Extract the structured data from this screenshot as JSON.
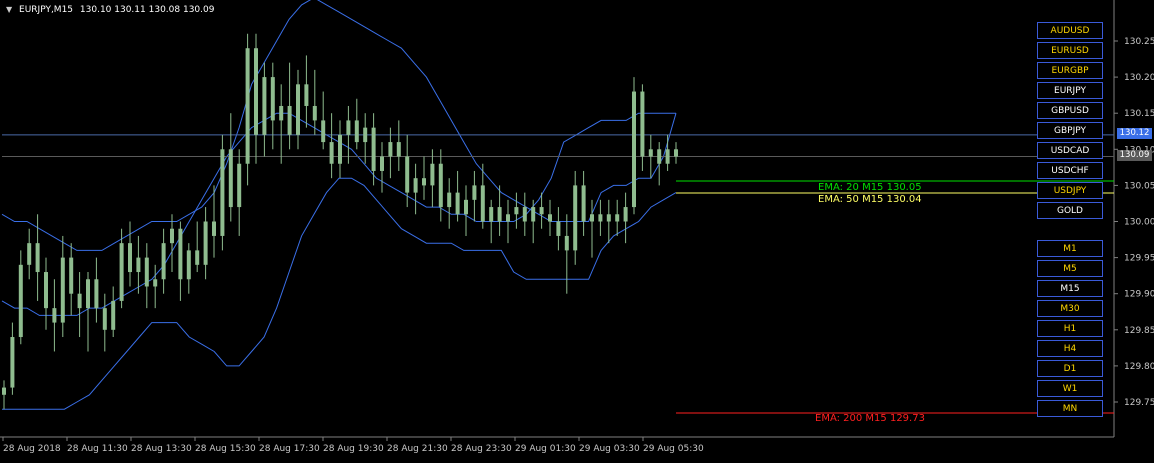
{
  "header": {
    "symbol": "EURJPY,M15",
    "ohlc": "130.10 130.11 130.08 130.09"
  },
  "colors": {
    "background": "#000000",
    "candle": "#8fbc8f",
    "bands": "#3a6fe8",
    "grid_line": "#4a6aa8",
    "ema20": "#00e000",
    "ema50": "#ffff66",
    "ema200": "#ff2020",
    "button_border": "#3a5ad8",
    "button_text_active": "#ffd700"
  },
  "price_axis": {
    "ticks": [
      "130.25",
      "130.20",
      "130.15",
      "130.10",
      "130.05",
      "130.00",
      "129.95",
      "129.90",
      "129.85",
      "129.80",
      "129.75"
    ],
    "current_tag": "130.09",
    "line_tag": "130.12",
    "tick_values": [
      130.25,
      130.2,
      130.15,
      130.1,
      130.05,
      130.0,
      129.95,
      129.9,
      129.85,
      129.8,
      129.75
    ]
  },
  "time_axis": {
    "ticks": [
      "28 Aug 2018",
      "28 Aug 11:30",
      "28 Aug 13:30",
      "28 Aug 15:30",
      "28 Aug 17:30",
      "28 Aug 19:30",
      "28 Aug 21:30",
      "28 Aug 23:30",
      "29 Aug 01:30",
      "29 Aug 03:30",
      "29 Aug 05:30"
    ]
  },
  "indicators": {
    "ema20": "EMA: 20  M15 130.05",
    "ema50": "EMA: 50  M15 130.04",
    "ema200": "EMA: 200  M15 129.73",
    "ema20_value": 130.055,
    "ema50_value": 130.038,
    "ema200_value": 129.73,
    "hline_value": 130.12
  },
  "symbols": [
    "AUDUSD",
    "EURUSD",
    "EURGBP",
    "EURJPY",
    "GBPUSD",
    "GBPJPY",
    "USDCAD",
    "USDCHF",
    "USDJPY",
    "GOLD"
  ],
  "timeframes": [
    "M1",
    "M5",
    "M15",
    "M30",
    "H1",
    "H4",
    "D1",
    "W1",
    "MN"
  ],
  "active_symbols": [
    "AUDUSD",
    "EURUSD",
    "EURGBP",
    "USDJPY"
  ],
  "active_timeframes": [
    "M1",
    "M5",
    "M30",
    "H1",
    "H4",
    "D1",
    "W1",
    "MN"
  ],
  "chart_data": {
    "type": "candlestick",
    "candles": [
      [
        129.76,
        129.78,
        129.74,
        129.77
      ],
      [
        129.77,
        129.86,
        129.76,
        129.84
      ],
      [
        129.84,
        129.96,
        129.83,
        129.94
      ],
      [
        129.94,
        129.99,
        129.92,
        129.97
      ],
      [
        129.97,
        130.01,
        129.89,
        129.93
      ],
      [
        129.93,
        129.95,
        129.85,
        129.88
      ],
      [
        129.88,
        129.92,
        129.82,
        129.86
      ],
      [
        129.86,
        129.98,
        129.84,
        129.95
      ],
      [
        129.95,
        129.97,
        129.87,
        129.9
      ],
      [
        129.9,
        129.93,
        129.84,
        129.88
      ],
      [
        129.88,
        129.93,
        129.82,
        129.92
      ],
      [
        129.92,
        129.95,
        129.86,
        129.88
      ],
      [
        129.88,
        129.9,
        129.82,
        129.85
      ],
      [
        129.85,
        129.91,
        129.84,
        129.89
      ],
      [
        129.89,
        129.99,
        129.88,
        129.97
      ],
      [
        129.97,
        130.0,
        129.91,
        129.93
      ],
      [
        129.93,
        129.98,
        129.9,
        129.95
      ],
      [
        129.95,
        129.97,
        129.88,
        129.91
      ],
      [
        129.91,
        129.94,
        129.88,
        129.92
      ],
      [
        129.92,
        129.99,
        129.9,
        129.97
      ],
      [
        129.97,
        130.01,
        129.93,
        129.99
      ],
      [
        129.99,
        130.0,
        129.89,
        129.92
      ],
      [
        129.92,
        129.97,
        129.9,
        129.96
      ],
      [
        129.96,
        130.0,
        129.93,
        129.94
      ],
      [
        129.94,
        130.02,
        129.92,
        130.0
      ],
      [
        130.0,
        130.05,
        129.95,
        129.98
      ],
      [
        129.98,
        130.12,
        129.96,
        130.1
      ],
      [
        130.1,
        130.15,
        130.0,
        130.02
      ],
      [
        130.02,
        130.1,
        129.98,
        130.08
      ],
      [
        130.08,
        130.26,
        130.05,
        130.24
      ],
      [
        130.24,
        130.26,
        130.08,
        130.12
      ],
      [
        130.12,
        130.22,
        130.09,
        130.2
      ],
      [
        130.2,
        130.22,
        130.1,
        130.14
      ],
      [
        130.14,
        130.19,
        130.08,
        130.16
      ],
      [
        130.16,
        130.22,
        130.1,
        130.12
      ],
      [
        130.12,
        130.21,
        130.1,
        130.19
      ],
      [
        130.19,
        130.23,
        130.13,
        130.16
      ],
      [
        130.16,
        130.21,
        130.12,
        130.14
      ],
      [
        130.14,
        130.18,
        130.1,
        130.11
      ],
      [
        130.11,
        130.15,
        130.06,
        130.08
      ],
      [
        130.08,
        130.14,
        130.06,
        130.12
      ],
      [
        130.12,
        130.16,
        130.08,
        130.14
      ],
      [
        130.14,
        130.17,
        130.1,
        130.11
      ],
      [
        130.11,
        130.15,
        130.08,
        130.13
      ],
      [
        130.13,
        130.15,
        130.05,
        130.07
      ],
      [
        130.07,
        130.11,
        130.04,
        130.09
      ],
      [
        130.09,
        130.13,
        130.06,
        130.11
      ],
      [
        130.11,
        130.14,
        130.07,
        130.09
      ],
      [
        130.09,
        130.12,
        130.02,
        130.04
      ],
      [
        130.04,
        130.08,
        130.01,
        130.06
      ],
      [
        130.06,
        130.09,
        130.03,
        130.05
      ],
      [
        130.05,
        130.1,
        130.02,
        130.08
      ],
      [
        130.08,
        130.1,
        130.0,
        130.02
      ],
      [
        130.02,
        130.06,
        129.99,
        130.04
      ],
      [
        130.04,
        130.07,
        130.0,
        130.01
      ],
      [
        130.01,
        130.05,
        129.98,
        130.03
      ],
      [
        130.03,
        130.07,
        130.0,
        130.05
      ],
      [
        130.05,
        130.08,
        129.99,
        130.0
      ],
      [
        130.0,
        130.03,
        129.97,
        130.02
      ],
      [
        130.02,
        130.05,
        129.98,
        130.0
      ],
      [
        130.0,
        130.03,
        129.97,
        130.01
      ],
      [
        130.01,
        130.04,
        129.99,
        130.02
      ],
      [
        130.02,
        130.04,
        129.98,
        130.0
      ],
      [
        130.0,
        130.03,
        129.97,
        130.02
      ],
      [
        130.02,
        130.04,
        129.99,
        130.01
      ],
      [
        130.01,
        130.03,
        129.98,
        130.0
      ],
      [
        130.0,
        130.02,
        129.96,
        129.98
      ],
      [
        129.98,
        130.01,
        129.9,
        129.96
      ],
      [
        129.96,
        130.07,
        129.94,
        130.05
      ],
      [
        130.05,
        130.07,
        129.98,
        130.0
      ],
      [
        130.0,
        130.03,
        129.95,
        130.01
      ],
      [
        130.01,
        130.03,
        129.98,
        130.0
      ],
      [
        130.0,
        130.03,
        129.97,
        130.01
      ],
      [
        130.01,
        130.03,
        129.98,
        130.0
      ],
      [
        130.0,
        130.04,
        129.97,
        130.02
      ],
      [
        130.02,
        130.2,
        130.01,
        130.18
      ],
      [
        130.18,
        130.19,
        130.07,
        130.09
      ],
      [
        130.09,
        130.12,
        130.06,
        130.1
      ],
      [
        130.1,
        130.11,
        130.05,
        130.08
      ],
      [
        130.08,
        130.12,
        130.07,
        130.1
      ],
      [
        130.1,
        130.11,
        130.08,
        130.09
      ]
    ],
    "upper_band": [
      130.01,
      130.0,
      130.0,
      129.99,
      129.98,
      129.97,
      129.96,
      129.96,
      129.96,
      129.97,
      129.98,
      129.99,
      130.0,
      130.0,
      130.0,
      130.01,
      130.02,
      130.04,
      130.08,
      130.13,
      130.19,
      130.22,
      130.25,
      130.28,
      130.3,
      130.31,
      130.3,
      130.29,
      130.28,
      130.27,
      130.26,
      130.25,
      130.24,
      130.22,
      130.2,
      130.17,
      130.14,
      130.11,
      130.08,
      130.06,
      130.04,
      130.03,
      130.02,
      130.01,
      130.0,
      130.0,
      130.0,
      130.0,
      130.04,
      130.05,
      130.05,
      130.06,
      130.06,
      130.09,
      130.15
    ],
    "middle_band": [
      129.89,
      129.88,
      129.88,
      129.87,
      129.87,
      129.87,
      129.87,
      129.88,
      129.88,
      129.89,
      129.9,
      129.91,
      129.92,
      129.94,
      129.97,
      130.0,
      130.03,
      130.06,
      130.09,
      130.11,
      130.13,
      130.14,
      130.15,
      130.15,
      130.14,
      130.13,
      130.12,
      130.11,
      130.1,
      130.08,
      130.06,
      130.05,
      130.04,
      130.03,
      130.02,
      130.02,
      130.01,
      130.01,
      130.0,
      130.0,
      130.0,
      130.0,
      130.01,
      130.03,
      130.06,
      130.11,
      130.12,
      130.13,
      130.14,
      130.14,
      130.14,
      130.15,
      130.15,
      130.15,
      130.15
    ],
    "lower_band": [
      129.74,
      129.74,
      129.74,
      129.74,
      129.74,
      129.74,
      129.75,
      129.76,
      129.78,
      129.8,
      129.82,
      129.84,
      129.86,
      129.86,
      129.86,
      129.84,
      129.83,
      129.82,
      129.8,
      129.8,
      129.82,
      129.84,
      129.88,
      129.93,
      129.98,
      130.01,
      130.04,
      130.06,
      130.06,
      130.05,
      130.03,
      130.01,
      129.99,
      129.98,
      129.97,
      129.97,
      129.97,
      129.96,
      129.96,
      129.96,
      129.96,
      129.93,
      129.92,
      129.92,
      129.92,
      129.92,
      129.92,
      129.92,
      129.96,
      129.98,
      129.99,
      130.0,
      130.02,
      130.03,
      130.04
    ]
  }
}
